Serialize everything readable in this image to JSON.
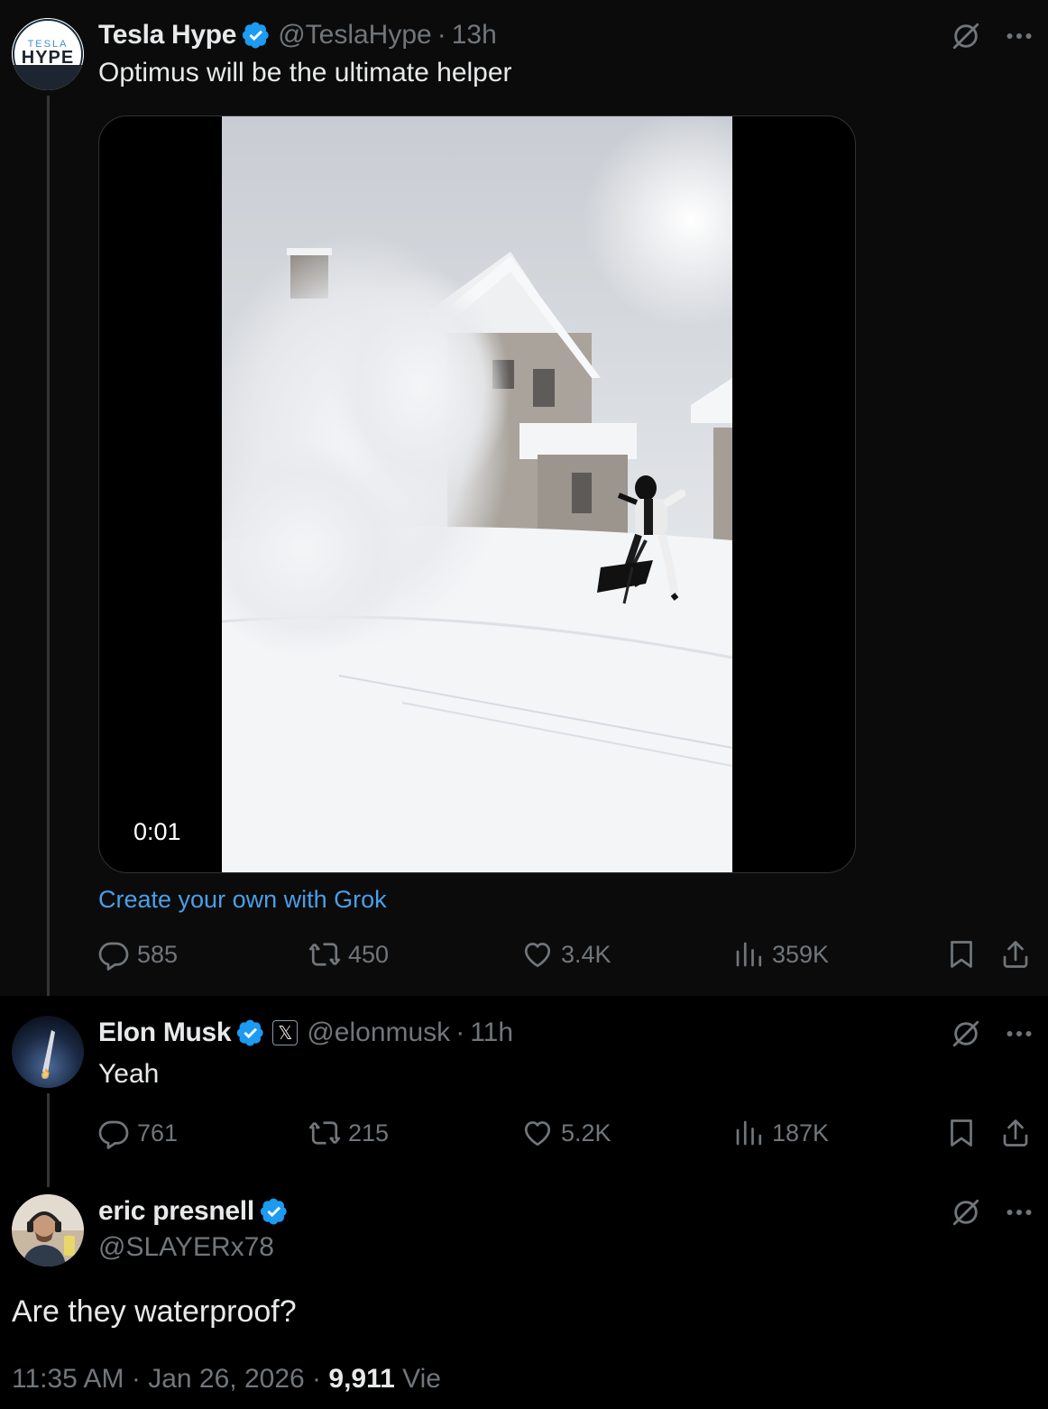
{
  "tweet1": {
    "display_name": "Tesla Hype",
    "handle": "@TeslaHype",
    "separator": "·",
    "time": "13h",
    "text": "Optimus will be the ultimate helper",
    "avatar_logo_top": "TESLA",
    "avatar_logo_bottom": "HYPE",
    "video_time": "0:01",
    "grok_link": "Create your own with Grok",
    "replies": "585",
    "reposts": "450",
    "likes": "3.4K",
    "views": "359K"
  },
  "tweet2": {
    "display_name": "Elon Musk",
    "affiliate_badge": "𝕏",
    "handle": "@elonmusk",
    "separator": "·",
    "time": "11h",
    "text": "Yeah",
    "replies": "761",
    "reposts": "215",
    "likes": "5.2K",
    "views": "187K"
  },
  "tweet3": {
    "display_name": "eric presnell",
    "handle": "@SLAYERx78",
    "text": "Are they waterproof?",
    "posted_time": "11:35 AM",
    "separator": "·",
    "posted_date": "Jan 26, 2026",
    "view_count": "9,911",
    "views_label": "Vie"
  },
  "icons": {
    "verified": "verified-badge-icon",
    "grok": "grok-icon",
    "more": "more-dots-icon",
    "reply": "reply-icon",
    "repost": "repost-icon",
    "like": "heart-icon",
    "views": "views-chart-icon",
    "bookmark": "bookmark-icon",
    "share": "share-icon"
  },
  "colors": {
    "background": "#000000",
    "thread_background": "#0b0b0b",
    "verified_blue": "#1d9bf0",
    "link_blue": "#4a9fe8",
    "muted": "#71767b",
    "text": "#e7e9ea"
  }
}
